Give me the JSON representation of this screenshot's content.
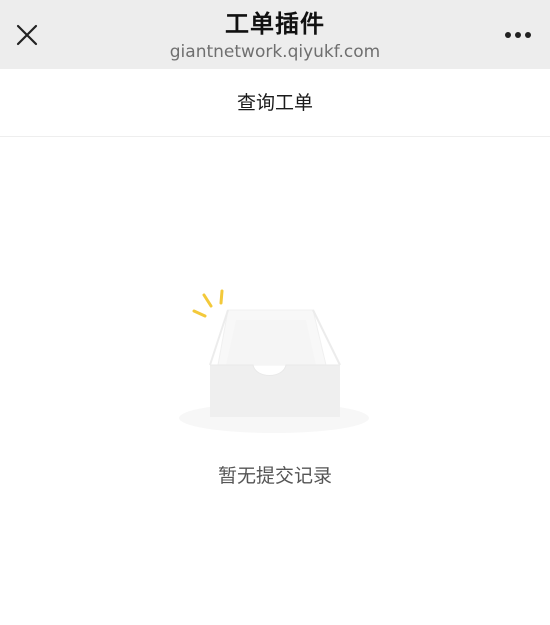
{
  "header": {
    "title": "工单插件",
    "subtitle": "giantnetwork.qiyukf.com",
    "close_icon": "close-icon",
    "more_icon": "more-icon"
  },
  "tab": {
    "label": "查询工单"
  },
  "empty_state": {
    "illustration_icon": "empty-box-icon",
    "message": "暂无提交记录"
  },
  "colors": {
    "header_bg": "#ededed",
    "sparkle": "#f3c93a",
    "box": "#f1f1f1"
  }
}
